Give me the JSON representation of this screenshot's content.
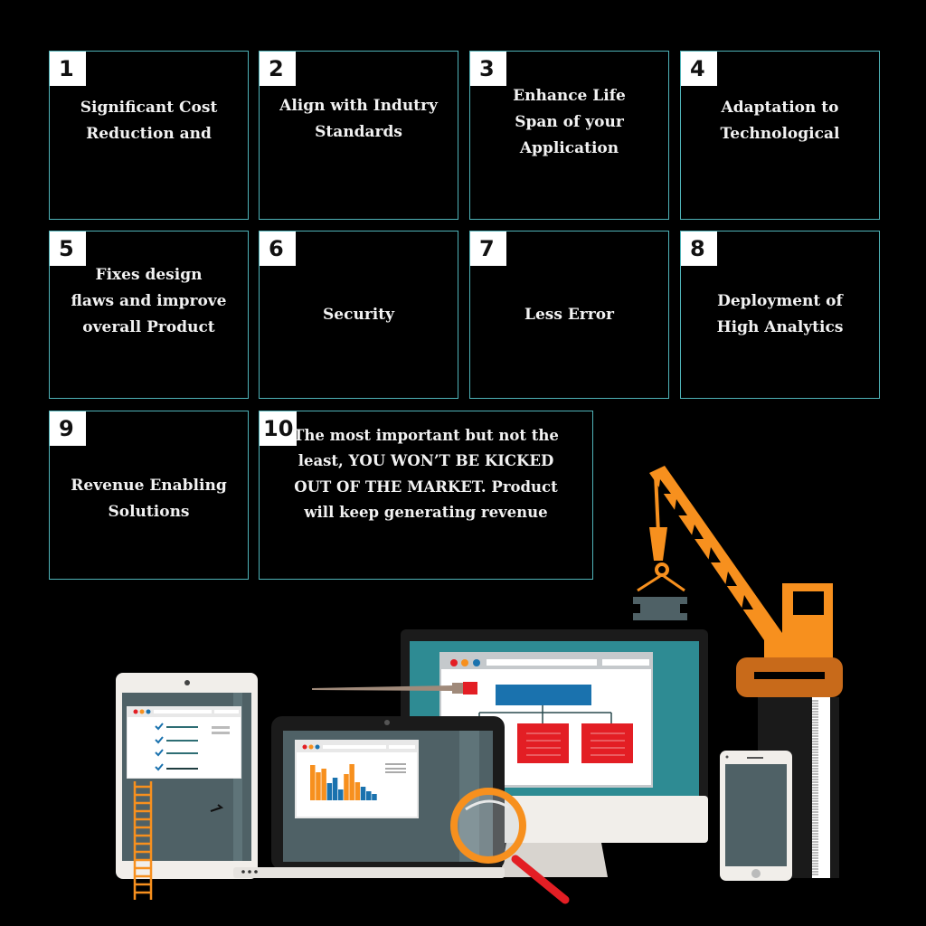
{
  "cards": [
    {
      "number": "1",
      "text": "Significant Cost\nReduction and"
    },
    {
      "number": "2",
      "text": "Align with Indutry\nStandards"
    },
    {
      "number": "3",
      "text": "Enhance Life\nSpan of your\nApplication"
    },
    {
      "number": "4",
      "text": "Adaptation to\nTechnological"
    },
    {
      "number": "5",
      "text": "Fixes design\nflaws and improve\noverall Product"
    },
    {
      "number": "6",
      "text": "Security"
    },
    {
      "number": "7",
      "text": "Less Error"
    },
    {
      "number": "8",
      "text": "Deployment of\nHigh Analytics"
    },
    {
      "number": "9",
      "text": "Revenue Enabling\nSolutions"
    },
    {
      "number": "10",
      "text": "The most important but not the\nleast, YOU WON’T BE KICKED\nOUT OF THE MARKET. Product\nwill keep generating revenue"
    }
  ],
  "colors": {
    "background": "#000000",
    "card_border": "#4fb3b8",
    "accent_orange": "#f7901e",
    "accent_blue": "#1a72ae",
    "accent_red": "#e31e24",
    "monitor_teal": "#2e8b93",
    "screen_gray": "#4f6166"
  },
  "illustration": {
    "description": "devices under construction: tablet with checklist, laptop with bar chart, desktop monitor with org chart, phone, crane, ladder, magnifying glass, paintbrush"
  }
}
